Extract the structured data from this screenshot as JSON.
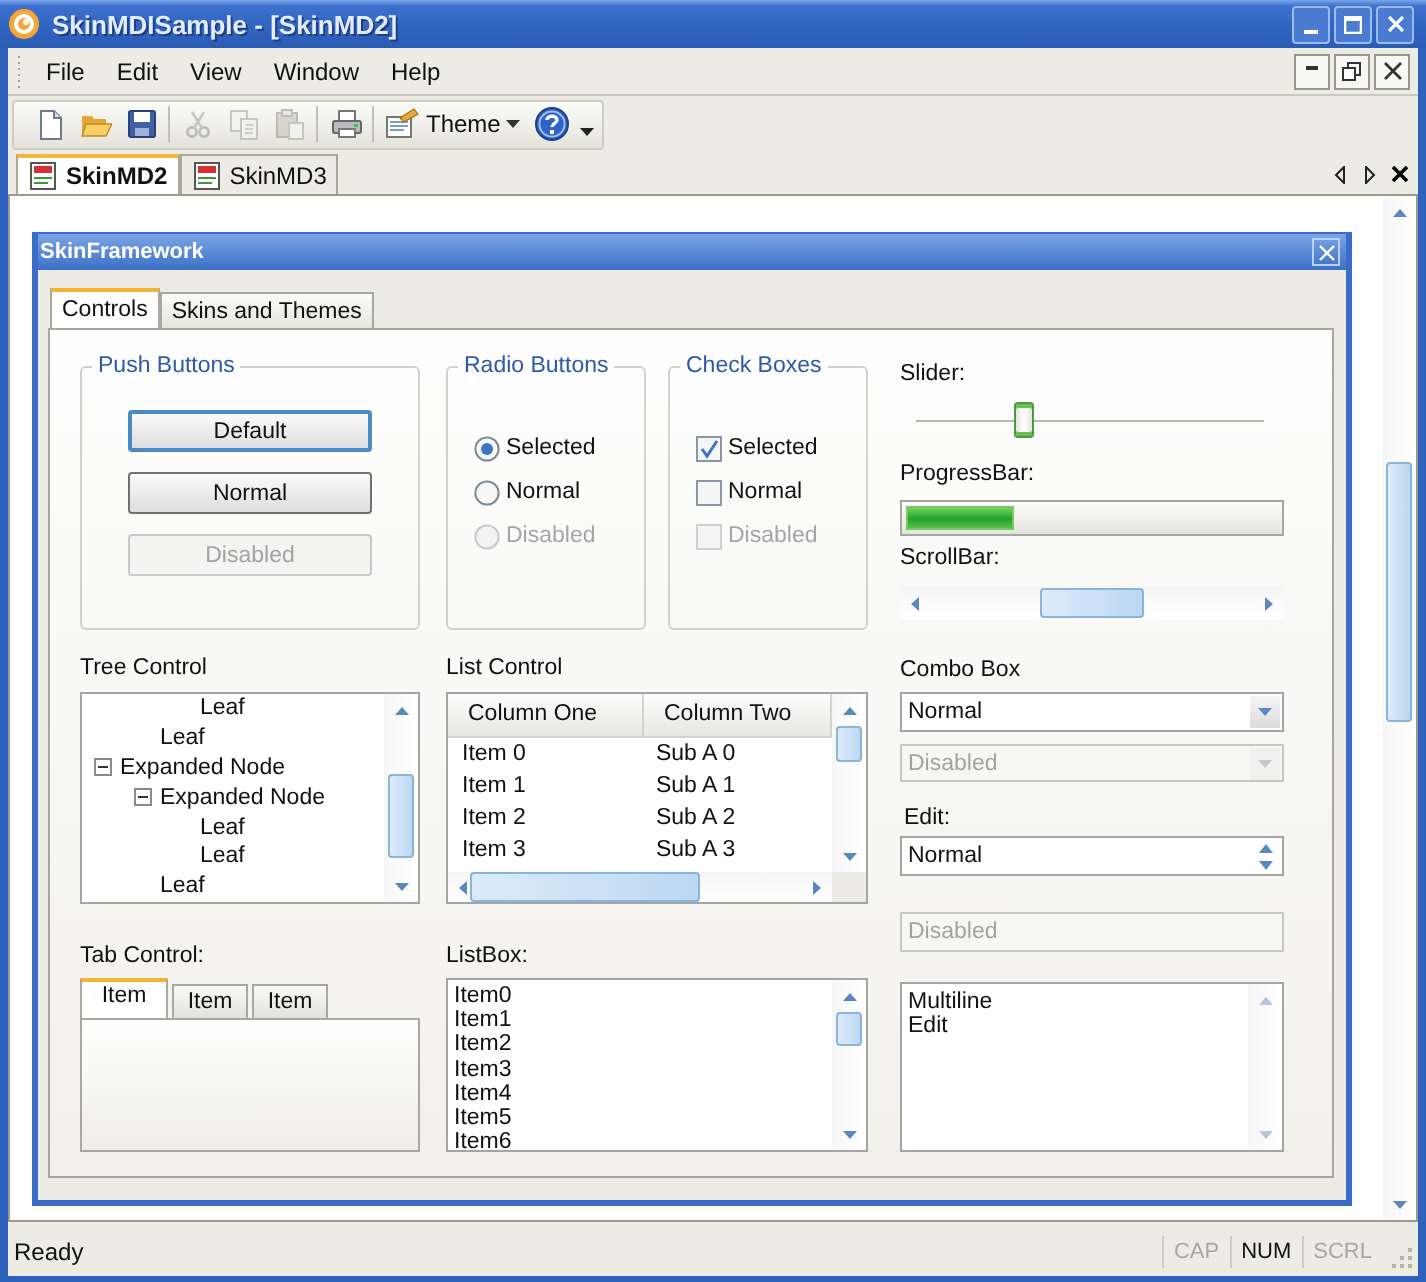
{
  "window": {
    "title": "SkinMDISample - [SkinMD2]"
  },
  "menu": [
    "File",
    "Edit",
    "View",
    "Window",
    "Help"
  ],
  "toolbar": {
    "buttons": [
      {
        "disabled": false
      },
      {
        "disabled": false
      },
      {
        "disabled": false
      },
      {
        "disabled": true
      },
      {
        "disabled": true
      },
      {
        "disabled": true
      },
      {
        "disabled": false
      }
    ],
    "theme_button": {
      "label": "Theme"
    }
  },
  "doc_tabs": [
    {
      "label": "SkinMD2",
      "selected": true
    },
    {
      "label": "SkinMD3",
      "selected": false
    }
  ],
  "child_window": {
    "title": "SkinFramework",
    "tabs": [
      {
        "label": "Controls",
        "selected": true
      },
      {
        "label": "Skins and Themes",
        "selected": false
      }
    ],
    "push_buttons": {
      "title": "Push Buttons",
      "buttons": [
        {
          "label": "Default",
          "default": true,
          "disabled": false
        },
        {
          "label": "Normal",
          "default": false,
          "disabled": false
        },
        {
          "label": "Disabled",
          "default": false,
          "disabled": true
        }
      ]
    },
    "radio_buttons": {
      "title": "Radio Buttons",
      "items": [
        {
          "label": "Selected",
          "selected": true,
          "disabled": false
        },
        {
          "label": "Normal",
          "selected": false,
          "disabled": false
        },
        {
          "label": "Disabled",
          "selected": false,
          "disabled": true
        }
      ]
    },
    "check_boxes": {
      "title": "Check Boxes",
      "items": [
        {
          "label": "Selected",
          "checked": true,
          "disabled": false
        },
        {
          "label": "Normal",
          "checked": false,
          "disabled": false
        },
        {
          "label": "Disabled",
          "checked": false,
          "disabled": true
        }
      ]
    },
    "slider": {
      "label": "Slider:",
      "level": 0.31
    },
    "progress_bar": {
      "label": "ProgressBar:",
      "level": 0.29
    },
    "scroll_bar": {
      "label": "ScrollBar:"
    },
    "tree": {
      "label": "Tree Control",
      "nodes": [
        {
          "children": [
            {
              "children": [
                {
                  "label": "Leaf"
                }
              ]
            },
            {
              "label": "Leaf"
            }
          ]
        },
        {
          "label": "Expanded Node",
          "expanded": true,
          "children": [
            {
              "label": "Expanded Node",
              "expanded": true,
              "children": [
                {
                  "label": "Leaf"
                },
                {
                  "label": "Leaf"
                }
              ]
            },
            {
              "label": "Leaf"
            }
          ]
        }
      ]
    },
    "list_control": {
      "label": "List Control",
      "columns": [
        "Column One",
        "Column Two"
      ],
      "rows": [
        [
          "Item 0",
          "Sub A 0"
        ],
        [
          "Item 1",
          "Sub A 1"
        ],
        [
          "Item 2",
          "Sub A 2"
        ],
        [
          "Item 3",
          "Sub A 3"
        ]
      ]
    },
    "tab_control": {
      "label": "Tab Control:",
      "tabs": [
        {
          "label": "Item",
          "selected": true
        },
        {
          "label": "Item",
          "selected": false
        },
        {
          "label": "Item",
          "selected": false
        }
      ]
    },
    "list_box": {
      "label": "ListBox:",
      "items": [
        "Item0",
        "Item1",
        "Item2",
        "Item3",
        "Item4",
        "Item5",
        "Item6"
      ]
    },
    "combo_box": {
      "label": "Combo Box",
      "fields": [
        {
          "value": "Normal",
          "disabled": false
        },
        {
          "value": "Disabled",
          "disabled": true
        }
      ]
    },
    "edit": {
      "label": "Edit:",
      "fields": [
        {
          "kind": "spin",
          "value": "Normal",
          "disabled": false
        },
        {
          "kind": "plain",
          "value": "Disabled",
          "disabled": true
        },
        {
          "kind": "multiline",
          "value": "Multiline\nEdit",
          "disabled": false
        }
      ]
    }
  },
  "status_bar": {
    "text": "Ready",
    "indicators": [
      {
        "label": "CAP",
        "on": false
      },
      {
        "label": "NUM",
        "on": true
      },
      {
        "label": "SCRL",
        "on": false
      }
    ]
  }
}
